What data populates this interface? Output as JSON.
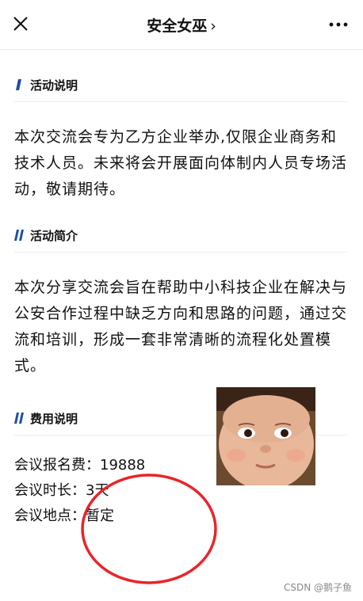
{
  "header": {
    "title": "安全女巫",
    "chevron": "›"
  },
  "sections": [
    {
      "heading": "活动说明",
      "body": "本次交流会专为乙方企业举办,仅限企业商务和技术人员。未来将会开展面向体制内人员专场活动，敬请期待。"
    },
    {
      "heading": "活动简介",
      "body": "本次分享交流会旨在帮助中小科技企业在解决与公安合作过程中缺乏方向和思路的问题，通过交流和培训，形成一套非常清晰的流程化处置模式。"
    },
    {
      "heading": "费用说明"
    }
  ],
  "fee": {
    "line1": "会议报名费：19888",
    "line2": "会议时长：3天",
    "line3": "会议地点：暂定"
  },
  "watermark": "CSDN @鹅子鱼",
  "colors": {
    "accent": "#1a4fa3",
    "circle": "#e8252a"
  },
  "icons": [
    "close-icon",
    "chevron-right-icon",
    "more-icon",
    "section-mark-icon"
  ]
}
